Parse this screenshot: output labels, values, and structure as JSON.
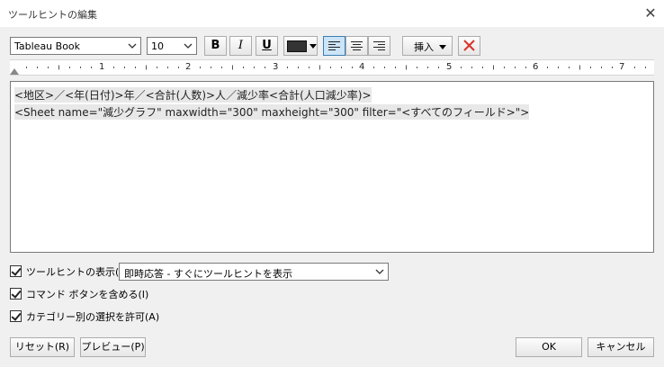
{
  "window": {
    "title": "ツールヒントの編集"
  },
  "toolbar": {
    "font_name": "Tableau Book",
    "font_size": "10",
    "bold_label": "B",
    "italic_label": "I",
    "underline_label": "U",
    "text_color": "#333333",
    "insert_label": "挿入",
    "clear_icon": "red-x-icon"
  },
  "ruler": {
    "marks": [
      "1",
      "2",
      "3",
      "4",
      "5",
      "6",
      "7"
    ]
  },
  "editor": {
    "line1": "<地区>／<年(日付)>年／<合計(人数)>人／減少率<合計(人口減少率)>",
    "line2": "<Sheet name=\"減少グラフ\" maxwidth=\"300\" maxheight=\"300\" filter=\"<すべてのフィールド>\">"
  },
  "options": {
    "show_tooltip_label": "ツールヒントの表示(S)",
    "show_tooltip_checked": true,
    "response_value": "即時応答 - すぐにツールヒントを表示",
    "include_command_label": "コマンド ボタンを含める(I)",
    "include_command_checked": true,
    "allow_selection_label": "カテゴリー別の選択を許可(A)",
    "allow_selection_checked": true
  },
  "buttons": {
    "reset": "リセット(R)",
    "preview": "プレビュー(P)",
    "ok": "OK",
    "cancel": "キャンセル"
  }
}
